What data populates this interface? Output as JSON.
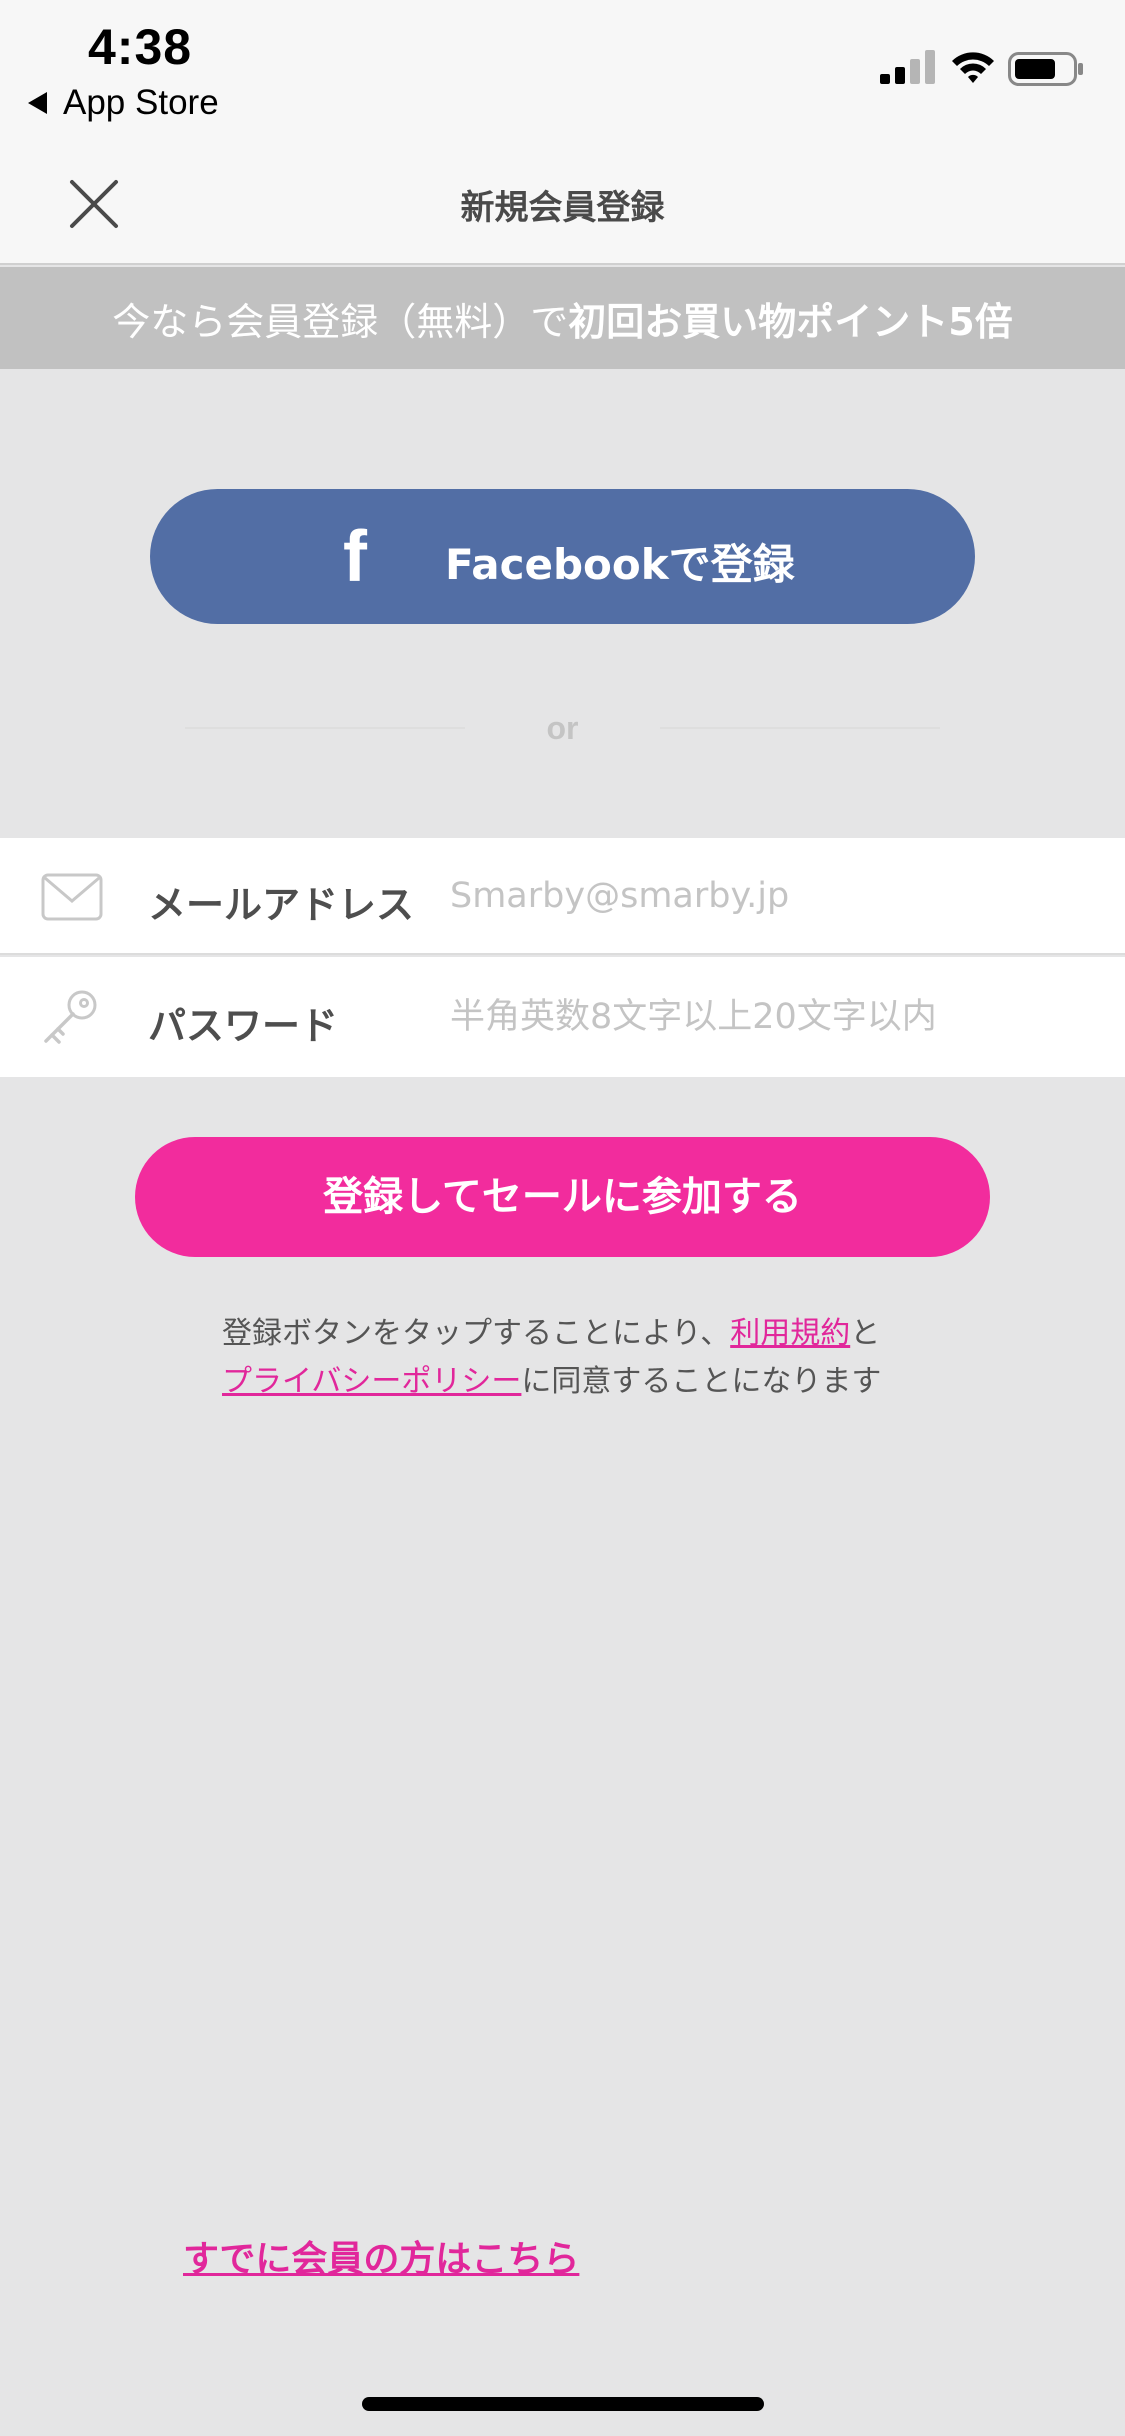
{
  "status_bar": {
    "time": "4:38",
    "back_label": "App Store",
    "icons": [
      "cellular-signal-icon",
      "wifi-icon",
      "battery-icon"
    ]
  },
  "nav": {
    "title": "新規会員登録",
    "close_icon": "close-icon"
  },
  "promo": {
    "prefix": "今なら会員登録（無料）で",
    "highlight": "初回お買い物ポイント5倍"
  },
  "facebook": {
    "icon": "facebook-icon",
    "icon_glyph": "f",
    "label": "Facebookで登録",
    "color": "#526ea5"
  },
  "divider": {
    "text": "or"
  },
  "form": {
    "email": {
      "icon": "envelope-icon",
      "label": "メールアドレス",
      "placeholder": "Smarby@smarby.jp",
      "value": ""
    },
    "password": {
      "icon": "key-icon",
      "label": "パスワード",
      "placeholder": "半角英数8文字以上20文字以内",
      "value": ""
    }
  },
  "submit": {
    "label": "登録してセールに参加する",
    "color": "#f22c9d"
  },
  "terms": {
    "line1_prefix": "登録ボタンをタップすることにより、",
    "terms_link": "利用規約",
    "line1_suffix": "と",
    "privacy_link": "プライバシーポリシー",
    "line2_suffix": "に同意することになります"
  },
  "member_link": "すでに会員の方はこちら",
  "colors": {
    "background": "#e5e5e6",
    "accent_pink": "#f22c9d",
    "link_pink": "#e1279b"
  }
}
